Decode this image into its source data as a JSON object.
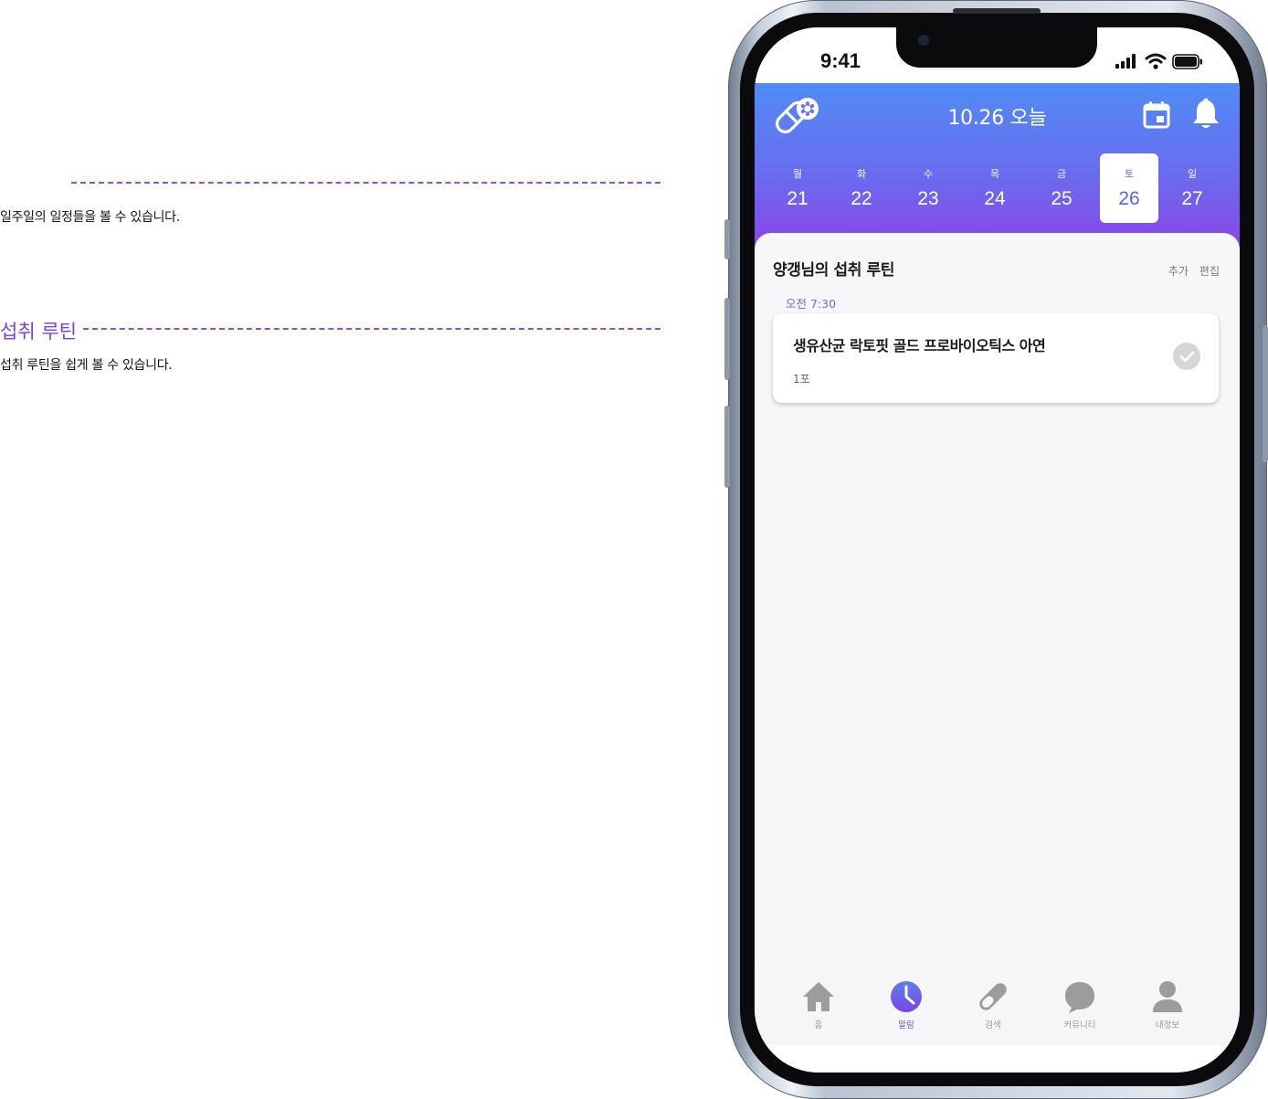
{
  "annotations": [
    {
      "title": "",
      "description": "일주일의 일정들을 볼 수 있습니다."
    },
    {
      "title": "섭취 루틴",
      "description": "섭취 루틴을 쉽게 볼 수 있습니다."
    }
  ],
  "status_bar": {
    "time": "9:41"
  },
  "header": {
    "title": "10.26 오늘",
    "icons": {
      "logo": "pill-logo-icon",
      "calendar": "calendar-icon",
      "notifications": "bell-icon"
    }
  },
  "week": [
    {
      "dow": "월",
      "date": "21"
    },
    {
      "dow": "화",
      "date": "22"
    },
    {
      "dow": "수",
      "date": "23"
    },
    {
      "dow": "목",
      "date": "24"
    },
    {
      "dow": "금",
      "date": "25"
    },
    {
      "dow": "토",
      "date": "26",
      "selected": true
    },
    {
      "dow": "일",
      "date": "27"
    }
  ],
  "routine": {
    "title": "양갱님의 섭취 루틴",
    "add_label": "추가",
    "edit_label": "편집",
    "entries": [
      {
        "time": "오전 7:30",
        "name": "생유산균 락토핏 골드 프로바이오틱스 아연",
        "quantity": "1포",
        "taken": false
      }
    ]
  },
  "tabbar": {
    "items": [
      {
        "label": "홈",
        "icon": "home-icon"
      },
      {
        "label": "알림",
        "icon": "clock-icon",
        "active": true
      },
      {
        "label": "검색",
        "icon": "pill-icon"
      },
      {
        "label": "커뮤니티",
        "icon": "chat-bubble-icon"
      },
      {
        "label": "내정보",
        "icon": "person-icon"
      }
    ]
  },
  "colors": {
    "accent": "#7b3fe0",
    "header_gradient_top": "#4f8cf5",
    "header_gradient_bottom": "#8a46e6",
    "selected_day_text": "#5b63e8",
    "time_label": "#5b6ee0"
  }
}
